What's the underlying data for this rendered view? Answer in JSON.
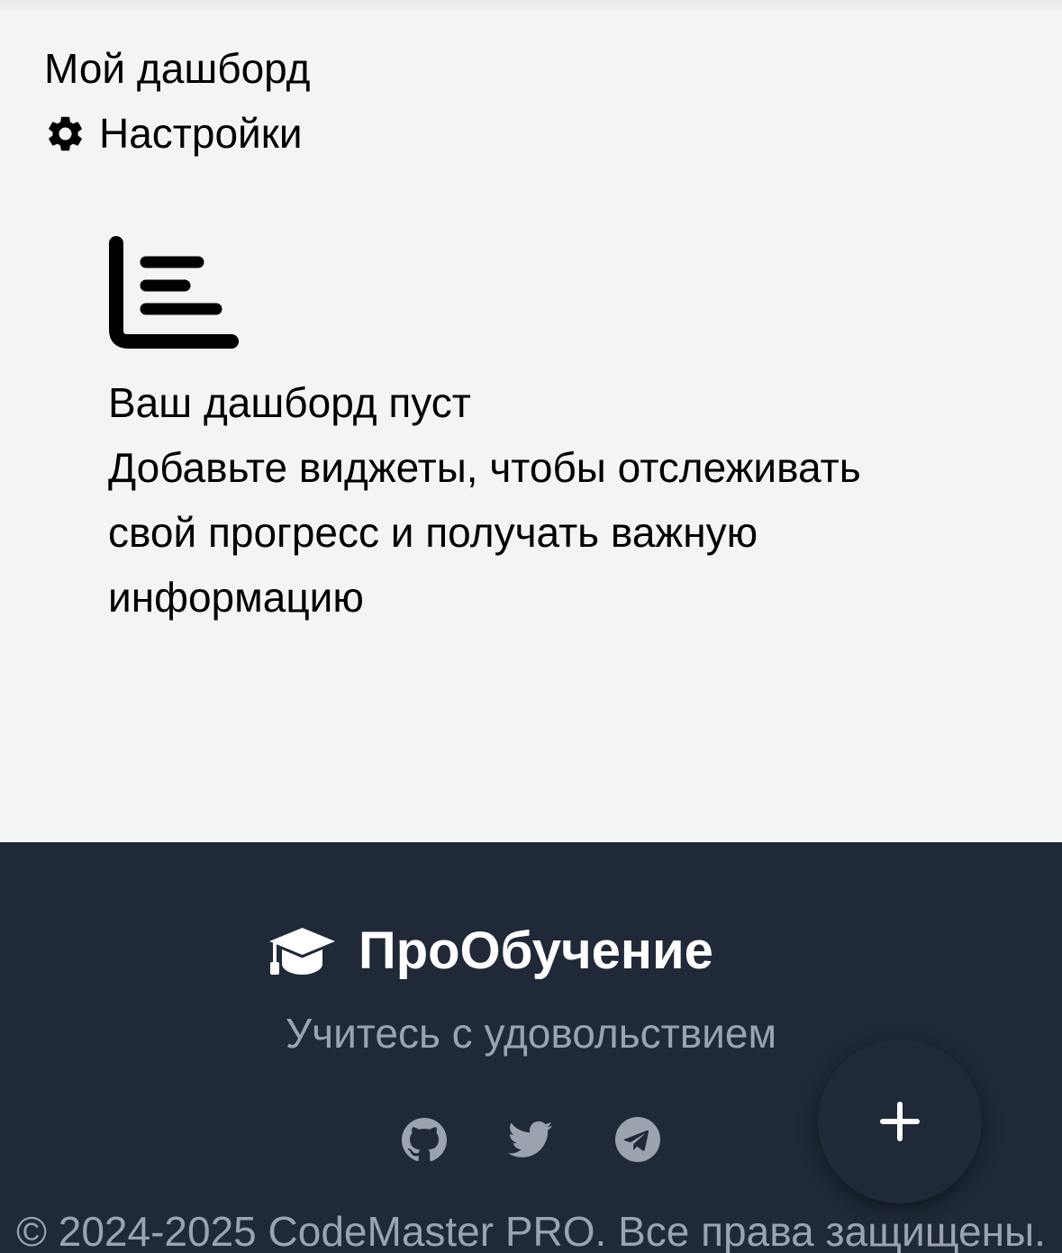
{
  "header": {
    "title": "Мой дашборд",
    "settings_label": "Настройки",
    "settings_icon": "gear-icon"
  },
  "empty_state": {
    "icon": "bar-chart-icon",
    "title": "Ваш дашборд пуст",
    "description": "Добавьте виджеты, чтобы отслеживать свой прогресс и получать важную информацию"
  },
  "footer": {
    "brand_icon": "graduation-cap-icon",
    "brand_name": "ПроОбучение",
    "tagline": "Учитесь с удовольствием",
    "social_links": [
      {
        "icon": "github-icon"
      },
      {
        "icon": "twitter-icon"
      },
      {
        "icon": "telegram-icon"
      }
    ],
    "copyright": "© 2024-2025 CodeMaster PRO. Все права защищены."
  },
  "fab": {
    "icon": "plus-icon"
  },
  "colors": {
    "background": "#f3f4f6",
    "footer_background": "#1f2937",
    "footer_muted_text": "#9ca3af",
    "social_icon": "#9ca3af",
    "text": "#000000",
    "white": "#ffffff"
  }
}
